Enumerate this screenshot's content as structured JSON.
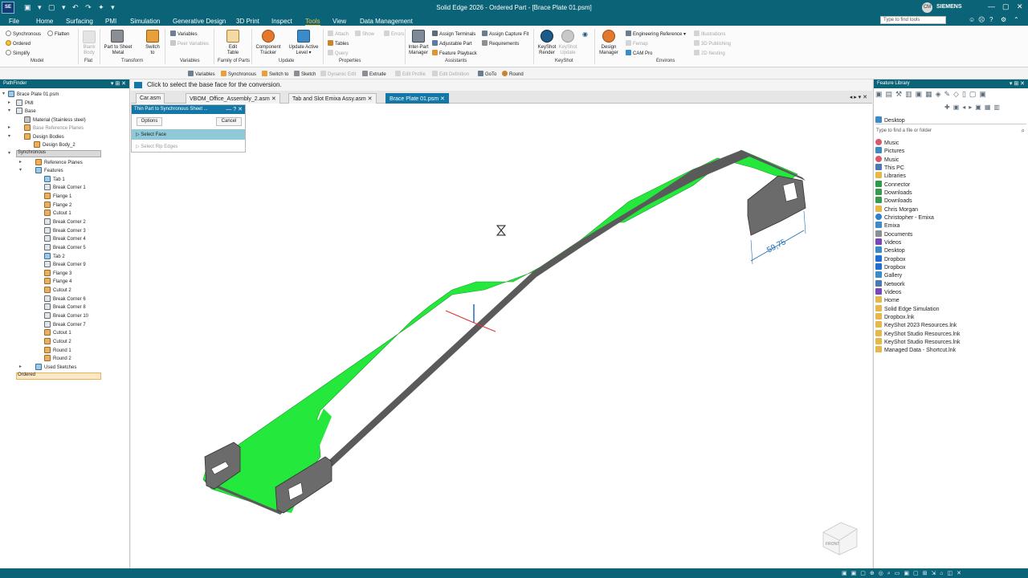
{
  "app": {
    "logo": "SE",
    "title": "Solid Edge 2026 - Ordered Part - [Brace Plate 01.psm]",
    "quick_access": "▣ ▾ ▢ ▾ ↶ ↷ ✦ ▾",
    "win_min": "—",
    "win_max": "▢",
    "win_close": "✕",
    "brand": "SIEMENS",
    "user_initials": "CM"
  },
  "menu": {
    "items": [
      "File",
      "Home",
      "Surfacing",
      "PMI",
      "Simulation",
      "Generative Design",
      "3D Print",
      "Inspect",
      "Tools",
      "View",
      "Data Management"
    ],
    "active": "Tools"
  },
  "search": {
    "placeholder": "Type to find tools"
  },
  "ribbon": {
    "model": {
      "synchronous": "Synchronous",
      "flatten": "Flatten",
      "ordered": "Ordered",
      "simplify": "Simplify",
      "label": "Model"
    },
    "flat": {
      "blank_body": "Blank Body",
      "label": "Flat"
    },
    "transform": {
      "part_to_sheet_metal": "Part to Sheet Metal",
      "switch_to": "Switch to",
      "label": "Transform"
    },
    "variables": {
      "variables": "Variables",
      "peer_variables": "Peer Variables",
      "label": "Variables"
    },
    "family": {
      "edit_table": "Edit Table",
      "label": "Family of Parts"
    },
    "update": {
      "component_tracker": "Component Tracker",
      "update_active_level": "Update Active Level ▾",
      "label": "Update"
    },
    "properties": {
      "attach": "Attach",
      "show": "Show",
      "errors": "Errors",
      "tables": "Tables",
      "query": "Query",
      "label": "Properties"
    },
    "assistants": {
      "inter_part_manager": "Inter-Part Manager",
      "assign_terminals": "Assign Terminals",
      "adjustable_part": "Adjustable Part",
      "feature_playback": "Feature Playback",
      "assign_capture_fit": "Assign Capture Fit",
      "requirements": "Requirements",
      "label": "Assistants"
    },
    "keyshot": {
      "render": "KeyShot Render",
      "update": "KeyShot Update",
      "label": "KeyShot"
    },
    "environs": {
      "design_manager": "Design Manager",
      "engineering_reference": "Engineering Reference ▾",
      "femap": "Femap",
      "cam_pro": "CAM Pro",
      "illustrations": "Illustrations",
      "publishing_3d": "3D Publishing",
      "nesting_2d": "2D Nesting",
      "label": "Environs"
    }
  },
  "command_bar": [
    "Variables",
    "Synchronous",
    "Switch to",
    "Sketch",
    "Dynamic Edit",
    "Extrude",
    "Edit Profile",
    "Edit Definition",
    "GoTo",
    "Round"
  ],
  "pathfinder": {
    "title": "PathFinder",
    "items": [
      {
        "label": "Brace Plate 01.psm"
      },
      {
        "label": "PMI"
      },
      {
        "label": "Base"
      },
      {
        "label": "Material (Stainless steel)"
      },
      {
        "label": "Base Reference Planes"
      },
      {
        "label": "Design Bodies"
      },
      {
        "label": "Design Body_2"
      },
      {
        "label": "Synchronous"
      },
      {
        "label": "Reference Planes"
      },
      {
        "label": "Features"
      },
      {
        "label": "Tab 1"
      },
      {
        "label": "Break Corner 1"
      },
      {
        "label": "Flange 1"
      },
      {
        "label": "Flange 2"
      },
      {
        "label": "Cutout 1"
      },
      {
        "label": "Break Corner 2"
      },
      {
        "label": "Break Corner 3"
      },
      {
        "label": "Break Corner 4"
      },
      {
        "label": "Break Corner 5"
      },
      {
        "label": "Tab 2"
      },
      {
        "label": "Break Corner 9"
      },
      {
        "label": "Flange 3"
      },
      {
        "label": "Flange 4"
      },
      {
        "label": "Cutout 2"
      },
      {
        "label": "Break Corner 6"
      },
      {
        "label": "Break Corner 8"
      },
      {
        "label": "Break Corner 10"
      },
      {
        "label": "Break Corner 7"
      },
      {
        "label": "Cutout 1"
      },
      {
        "label": "Cutout 2"
      },
      {
        "label": "Round 1"
      },
      {
        "label": "Round 2"
      },
      {
        "label": "Used Sketches"
      },
      {
        "label": "Ordered"
      }
    ]
  },
  "prompt": "Click to select the base face for the conversion.",
  "tabs": [
    {
      "label": "Car.asm"
    },
    {
      "label": "VBOM_Office_Assembly_2.asm"
    },
    {
      "label": "Tab and Slot Emixa Assy.asm"
    },
    {
      "label": "Brace Plate 01.psm"
    }
  ],
  "dialog": {
    "title": "Thin Part to Synchronous Sheet ...",
    "options": "Options",
    "cancel": "Cancel",
    "select_face": "Select Face",
    "select_rip_edges": "Select Rip Edges"
  },
  "viewport": {
    "dimension": "59,75",
    "cube_label": "FRONT"
  },
  "feature_library": {
    "title": "Feature Library",
    "location": "Desktop",
    "search_placeholder": "Type to find a file or folder",
    "items": [
      "Music",
      "Pictures",
      "Music",
      "This PC",
      "Libraries",
      "Connector",
      "Downloads",
      "Downloads",
      "Chris Morgan",
      "Christopher - Emixa",
      "Emixa",
      "Documents",
      "Videos",
      "Desktop",
      "Dropbox",
      "Dropbox",
      "Gallery",
      "Network",
      "Videos",
      "Home",
      "Solid Edge Simulation",
      "Dropbox.lnk",
      "KeyShot 2023 Resources.lnk",
      "KeyShot Studio Resources.lnk",
      "KeyShot Studio Resources.lnk",
      "Managed Data - Shortcut.lnk"
    ]
  },
  "colors": {
    "brand": "#0a6376",
    "active_tab": "#1378a8",
    "part_green": "#25e83c",
    "tool_highlight": "#f6c343"
  }
}
